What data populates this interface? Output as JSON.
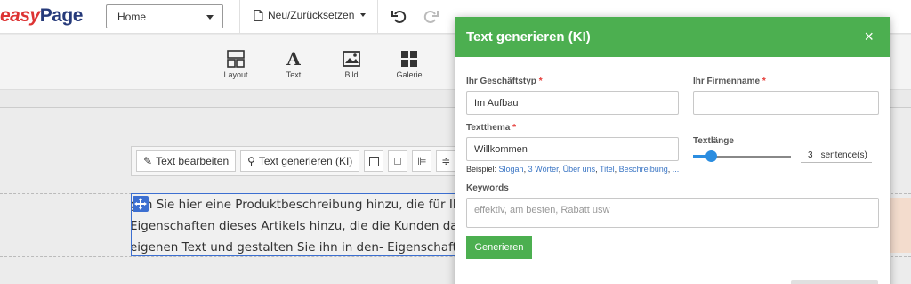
{
  "app": {
    "logo_part1": "easy",
    "logo_part2": "Page"
  },
  "topbar": {
    "page_select": "Home",
    "neu_label": "Neu/Zurücksetzen"
  },
  "toolbar": {
    "tools": [
      {
        "label": "Layout",
        "icon": "layout-icon"
      },
      {
        "label": "Text",
        "icon": "text-icon"
      },
      {
        "label": "Bild",
        "icon": "image-icon"
      },
      {
        "label": "Galerie",
        "icon": "gallery-icon"
      }
    ]
  },
  "context_toolbar": {
    "edit_text": "Text bearbeiten",
    "generate_text": "Text generieren (KI)"
  },
  "canvas": {
    "lines": [
      "gen Sie hier eine Produktbeschreibung hinzu, die für Ihre K",
      "Eigenschaften dieses Artikels hinzu, die die Kunden dazu bri",
      "eigenen Text und gestalten Sie ihn in den- Eigenschaften auf"
    ]
  },
  "modal": {
    "title": "Text generieren (KI)",
    "close": "×",
    "business_type_label": "Ihr Geschäftstyp",
    "business_type_value": "Im Aufbau",
    "company_name_label": "Ihr Firmenname",
    "company_name_value": "",
    "topic_label": "Textthema",
    "topic_value": "Willkommen",
    "examples_prefix": "Beispiel: ",
    "examples": [
      "Slogan",
      "3 Wörter",
      "Über uns",
      "Titel",
      "Beschreibung",
      "..."
    ],
    "length_label": "Textlänge",
    "length_value": "3",
    "length_unit": "sentence(s)",
    "length_fraction": 0.18,
    "keywords_label": "Keywords",
    "keywords_placeholder": "effektiv, am besten, Rabatt usw",
    "generate_button": "Generieren",
    "required_mark": "*"
  },
  "colors": {
    "accent": "#4caf50",
    "link": "#3a75c4",
    "slider": "#2b8de0",
    "selection": "#3c6fd1"
  }
}
